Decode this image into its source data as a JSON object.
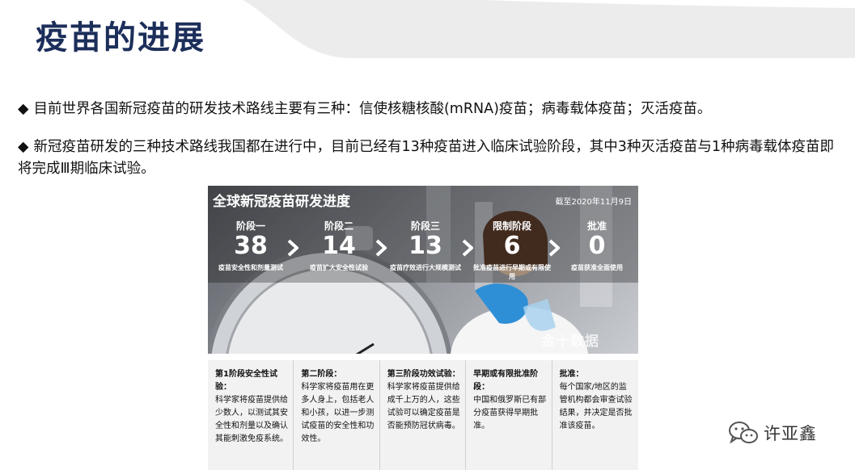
{
  "page": {
    "title": "疫苗的进展",
    "bullets": [
      {
        "marker": "◆",
        "text": "目前世界各国新冠疫苗的研发技术路线主要有三种：信使核糖核酸(mRNA)疫苗；病毒载体疫苗；灭活疫苗。"
      },
      {
        "marker": "◆",
        "text": "新冠疫苗研发的三种技术路线我国都在进行中，目前已经有13种疫苗进入临床试验阶段，其中3种灭活疫苗与1种病毒载体疫苗即将完成Ⅲ期临床试验。"
      }
    ]
  },
  "figure": {
    "title": "全球新冠疫苗研发进度",
    "date": "截至2020年11月9日",
    "watermark": "金十数据",
    "stages": [
      {
        "name": "阶段一",
        "count": "38",
        "desc": "疫苗安全性和剂量测试"
      },
      {
        "name": "阶段二",
        "count": "14",
        "desc": "疫苗扩大安全性试验"
      },
      {
        "name": "阶段三",
        "count": "13",
        "desc": "疫苗疗效进行大规模测试"
      },
      {
        "name": "限制阶段",
        "count": "6",
        "desc": "批准疫苗进行早期或有限使用"
      },
      {
        "name": "批准",
        "count": "0",
        "desc": "疫苗获准全面使用"
      }
    ],
    "descriptions": [
      {
        "heading": "第1阶段安全性试验：",
        "text": "科学家将疫苗提供给少数人，以测试其安全性和剂量以及确认其能刺激免疫系统。"
      },
      {
        "heading": "第二阶段：",
        "text": "科学家将疫苗用在更多人身上，包括老人和小孩，以进一步测试疫苗的安全性和功效性。"
      },
      {
        "heading": "第三阶段功效试验：",
        "text": "科学家将疫苗提供给成千上万的人，这些试验可以确定疫苗是否能预防冠状病毒。"
      },
      {
        "heading": "早期或有限批准阶段：",
        "text": "中国和俄罗斯已有部分疫苗获得早期批准。"
      },
      {
        "heading": "批准：",
        "text": "每个国家/地区的监管机构都会审查试验结果，并决定是否批准该疫苗。"
      }
    ]
  },
  "brand": {
    "name": "许亚鑫",
    "icon": "wechat-icon"
  },
  "colors": {
    "title": "#1c2e5a",
    "band": "#ececec",
    "stage_text": "#ffffff",
    "glove": "#2f8fd6"
  }
}
